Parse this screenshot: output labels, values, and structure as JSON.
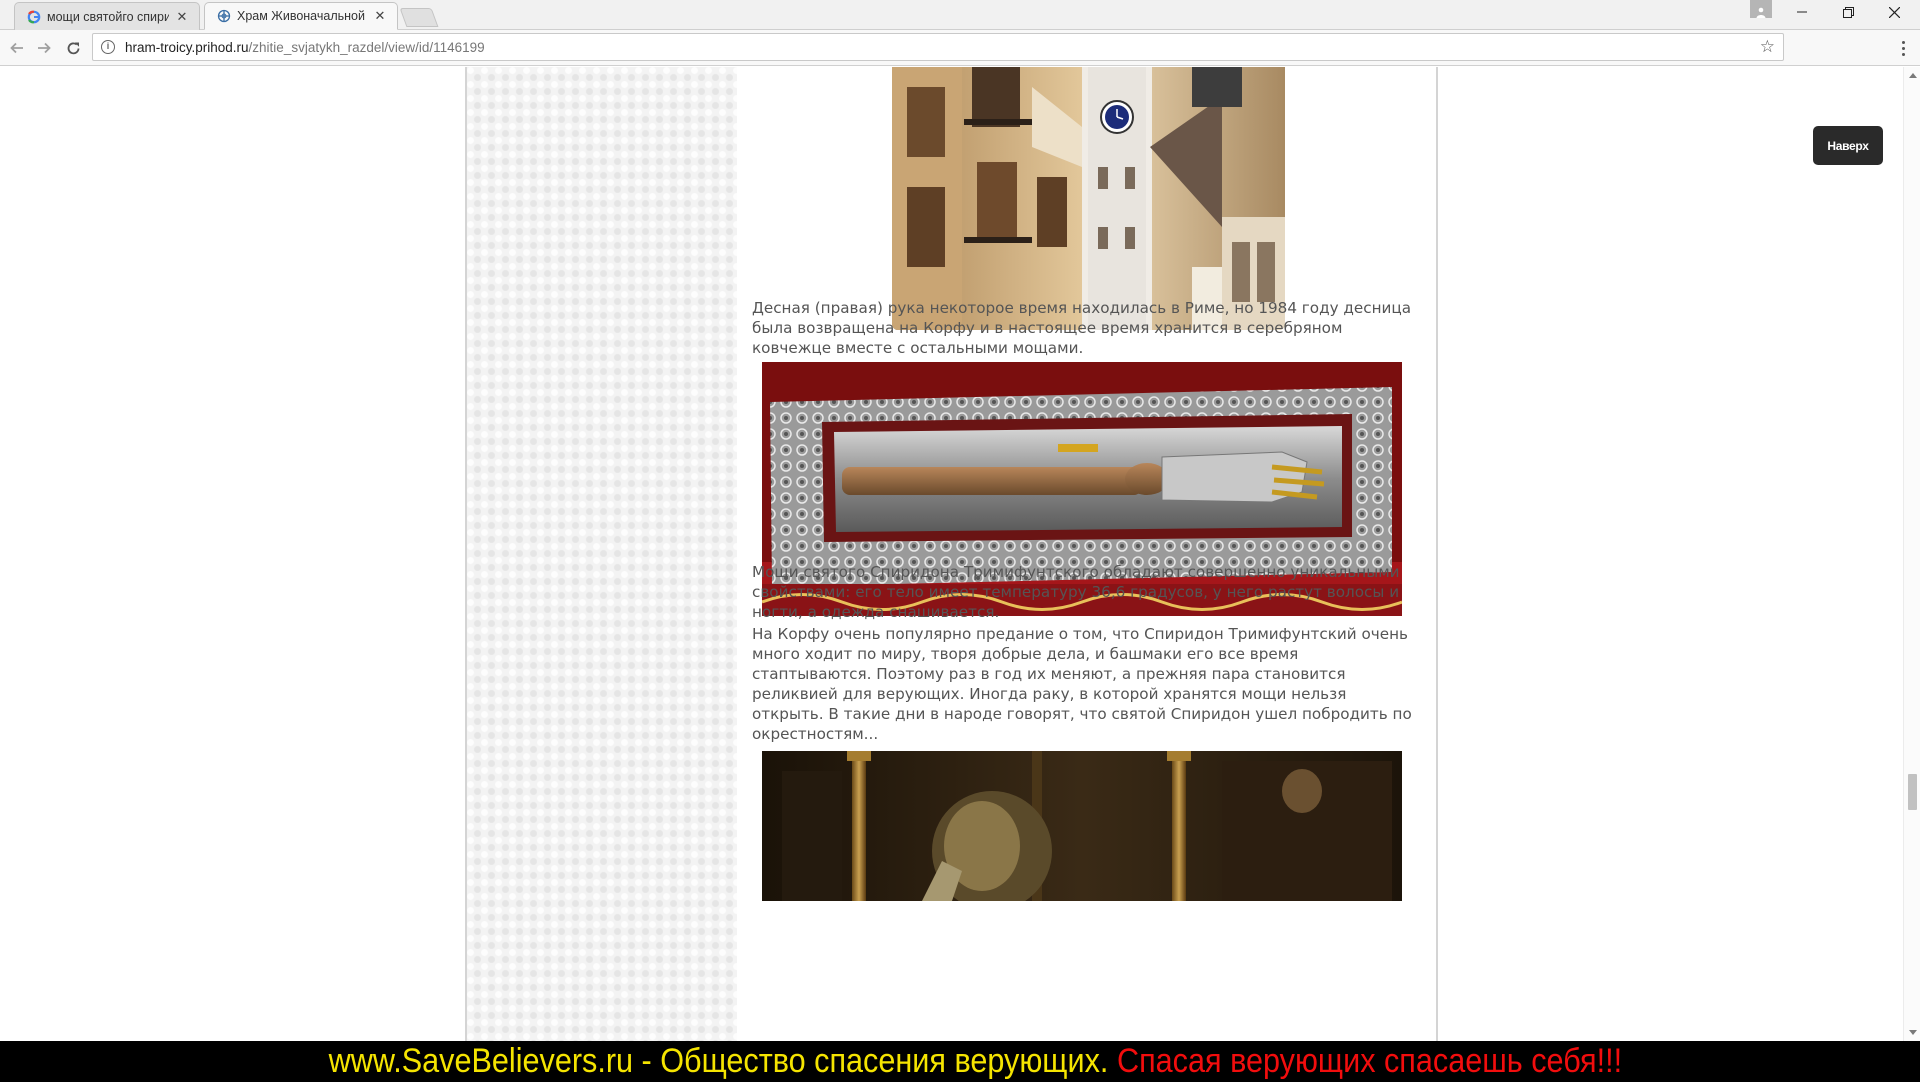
{
  "browser": {
    "tabs": [
      {
        "title": "мощи святойго спирид",
        "favicon": "google-g-icon"
      },
      {
        "title": "Храм Живоначальной Т",
        "favicon": "site-globe-icon"
      }
    ],
    "address": {
      "host": "hram-troicy.prihod.ru",
      "path": "/zhitie_svjatykh_razdel/view/id/1146199"
    }
  },
  "article": {
    "paragraphs": [
      "Десная (правая) рука некоторое время находилась в Риме, но 1984 году десница была возвращена на Корфу и в настоящее время хранится в серебряном ковчежце вместе с остальными мощами.",
      "Мощи святого Спиридона Тримифунтского обладают совершенно уникальными свойствами: его тело имеет температуру 36,6 градусов, у него растут волосы и ногти, а одежда снашивается.",
      "На Корфу очень популярно предание о том, что Спиридон Тримифунтский очень много ходит по миру, творя добрые дела, и башмаки его все время стаптываются. Поэтому раз в год их меняют, а прежняя пара становится реликвией для верующих. Иногда раку, в которой хранятся мощи нельзя открыть. В такие дни в народе говорят, что святой Спиридон ушел побродить по окрестностям..."
    ]
  },
  "to_top": {
    "label": "Наверх"
  },
  "banner": {
    "part1": "www.SaveBelievers.ru - Общество спасения верующих.",
    "part2": "Спасая верующих спасаешь себя!!!"
  },
  "colors": {
    "banner_bg": "#000000",
    "banner_yellow": "#f5e400",
    "banner_red": "#f20d0d",
    "text": "#555555",
    "to_top_bg": "#2a2a2a"
  }
}
